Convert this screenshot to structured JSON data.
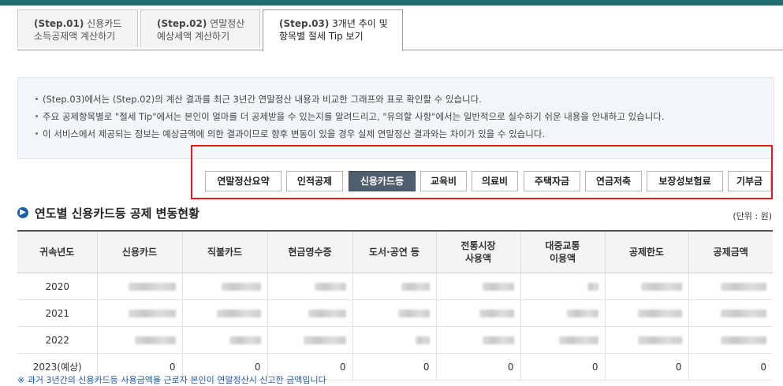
{
  "tabs": [
    {
      "step": "(Step.01)",
      "line1": "신용카드",
      "line2": "소득공제액 계산하기"
    },
    {
      "step": "(Step.02)",
      "line1": "연말정산",
      "line2": "예상세액 계산하기"
    },
    {
      "step": "(Step.03)",
      "line1": "3개년 추이 및",
      "line2": "항목별 절세 Tip 보기"
    }
  ],
  "info_lines": [
    "(Step.03)에서는 (Step.02)의 계산 결과를 최근 3년간 연말정산 내용과 비교한 그래프와 표로 확인할 수 있습니다.",
    "주요 공제항목별로 \"절세 Tip\"에서는 본인이 얼마를 더 공제받을 수 있는지를 알려드리고, \"유의할 사항\"에서는 일반적으로 실수하기 쉬운 내용을 안내하고 있습니다.",
    "이 서비스에서 제공되는 정보는 예상금액에 의한 결과이므로 향후 변동이 있을 경우 실제 연말정산 결과와는 차이가 있을 수 있습니다."
  ],
  "categories": [
    "연말정산요약",
    "인적공제",
    "신용카드등",
    "교육비",
    "의료비",
    "주택자금",
    "연금저축",
    "보장성보험료",
    "기부금"
  ],
  "active_category": "신용카드등",
  "section": {
    "title": "연도별 신용카드등 공제 변동현황",
    "unit": "(단위 : 원)"
  },
  "table": {
    "headers": [
      "귀속년도",
      "신용카드",
      "직불카드",
      "현금영수증",
      "도서·공연 등",
      "전통시장\n사용액",
      "대중교통\n이용액",
      "공제한도",
      "공제금액"
    ],
    "rows": [
      {
        "year": "2020",
        "values": [
          "",
          "",
          "",
          "",
          "",
          "",
          "",
          ""
        ]
      },
      {
        "year": "2021",
        "values": [
          "",
          "",
          "",
          "",
          "",
          "",
          "",
          ""
        ]
      },
      {
        "year": "2022",
        "values": [
          "",
          "",
          "",
          "",
          "",
          "",
          "",
          ""
        ]
      },
      {
        "year": "2023(예상)",
        "values": [
          "0",
          "0",
          "0",
          "0",
          "0",
          "0",
          "0",
          "0"
        ]
      }
    ]
  },
  "footnote": "※ 과거 3년간의 신용카드등 사용금액을 근로자 본인이 연말정산시 신고한 금액입니다",
  "colors": {
    "accent": "#1f6f73",
    "active_button": "#505f6e",
    "highlight_box": "#e31b1b",
    "section_icon": "#1f5ea8"
  }
}
